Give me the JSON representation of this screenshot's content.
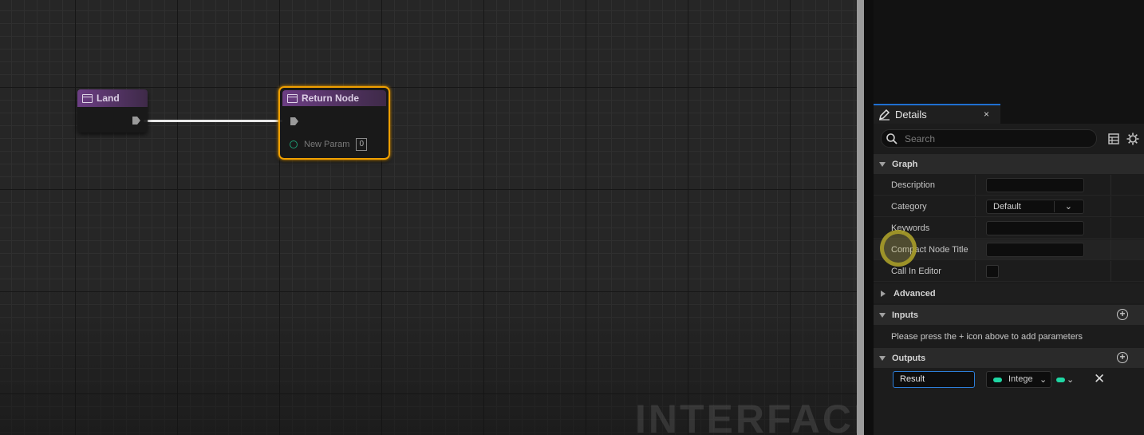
{
  "graph": {
    "nodes": {
      "land": {
        "title": "Land"
      },
      "return": {
        "title": "Return Node",
        "param_label": "New Param",
        "param_value": "0"
      }
    },
    "watermark": "INTERFACE"
  },
  "details": {
    "tab_label": "Details",
    "tab_close": "×",
    "search_placeholder": "Search",
    "sections": {
      "graph": "Graph",
      "advanced": "Advanced",
      "inputs": "Inputs",
      "outputs": "Outputs"
    },
    "properties": {
      "description": {
        "label": "Description",
        "value": ""
      },
      "category": {
        "label": "Category",
        "value": "Default"
      },
      "keywords": {
        "label": "Keywords",
        "value": ""
      },
      "compact_node_title": {
        "label": "Compact Node Title",
        "value": ""
      },
      "call_in_editor": {
        "label": "Call In Editor",
        "checked": false
      }
    },
    "inputs_hint": "Please press the + icon above to add parameters",
    "outputs": [
      {
        "name": "Result",
        "type": "Intege",
        "type_color": "#1fd6a3"
      }
    ]
  },
  "colors": {
    "accent": "#1f6fd1",
    "selection": "#f0a000",
    "function_header": "#6c3e84",
    "integer_pin": "#1fd6a3"
  }
}
